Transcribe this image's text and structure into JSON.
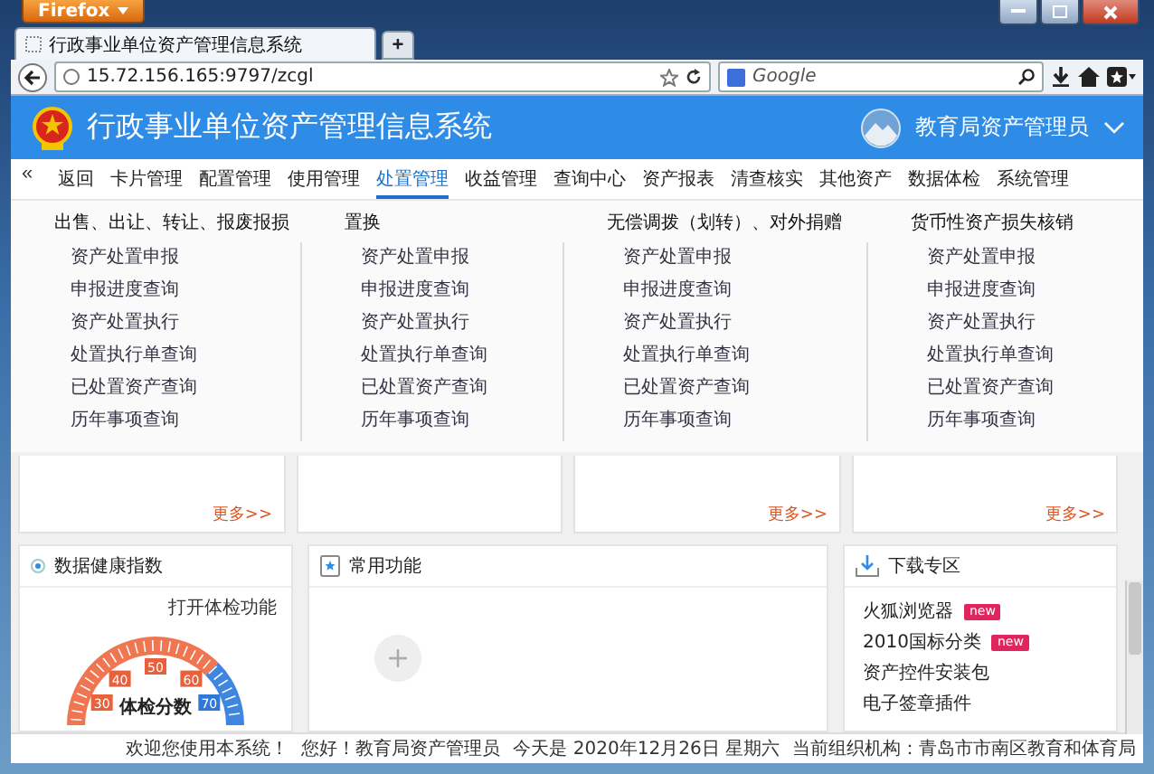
{
  "browser": {
    "menu_button": "Firefox",
    "tab_title": "行政事业单位资产管理信息系统",
    "new_tab": "+",
    "url": "15.72.156.165:9797/zcgl",
    "search_placeholder": "Google"
  },
  "app": {
    "title": "行政事业单位资产管理信息系统",
    "user": "教育局资产管理员"
  },
  "nav": {
    "collapse": "«",
    "items": [
      {
        "label": "返回",
        "selected": false
      },
      {
        "label": "卡片管理",
        "selected": false
      },
      {
        "label": "配置管理",
        "selected": false
      },
      {
        "label": "使用管理",
        "selected": false
      },
      {
        "label": "处置管理",
        "selected": true
      },
      {
        "label": "收益管理",
        "selected": false
      },
      {
        "label": "查询中心",
        "selected": false
      },
      {
        "label": "资产报表",
        "selected": false
      },
      {
        "label": "清查核实",
        "selected": false
      },
      {
        "label": "其他资产",
        "selected": false
      },
      {
        "label": "数据体检",
        "selected": false
      },
      {
        "label": "系统管理",
        "selected": false
      }
    ]
  },
  "menu_columns": [
    {
      "title": "出售、出让、转让、报废报损",
      "links": [
        "资产处置申报",
        "申报进度查询",
        "资产处置执行",
        "处置执行单查询",
        "已处置资产查询",
        "历年事项查询"
      ]
    },
    {
      "title": "置换",
      "links": [
        "资产处置申报",
        "申报进度查询",
        "资产处置执行",
        "处置执行单查询",
        "已处置资产查询",
        "历年事项查询"
      ]
    },
    {
      "title": "无偿调拨（划转）、对外捐赠",
      "links": [
        "资产处置申报",
        "申报进度查询",
        "资产处置执行",
        "处置执行单查询",
        "已处置资产查询",
        "历年事项查询"
      ]
    },
    {
      "title": "货币性资产损失核销",
      "links": [
        "资产处置申报",
        "申报进度查询",
        "资产处置执行",
        "处置执行单查询",
        "已处置资产查询",
        "历年事项查询"
      ]
    }
  ],
  "cards": [
    {
      "kind": "more",
      "more": "更多>>"
    },
    {
      "kind": "plain"
    },
    {
      "kind": "more",
      "more": "更多>>"
    },
    {
      "kind": "more",
      "more": "更多>>"
    }
  ],
  "health": {
    "title": "数据健康指数",
    "action": "打开体检功能",
    "score_label": "体检分数",
    "gauge_labels": [
      {
        "text": "30",
        "color": "#e8603c"
      },
      {
        "text": "40",
        "color": "#e8603c"
      },
      {
        "text": "50",
        "color": "#e8603c"
      },
      {
        "text": "60",
        "color": "#e8603c"
      },
      {
        "text": "70",
        "color": "#2f78d8"
      }
    ]
  },
  "common": {
    "title": "常用功能"
  },
  "downloads": {
    "title": "下载专区",
    "items": [
      {
        "label": "火狐浏览器",
        "badge": "new"
      },
      {
        "label": "2010国标分类",
        "badge": "new"
      },
      {
        "label": "资产控件安装包"
      },
      {
        "label": "电子签章插件"
      }
    ]
  },
  "status_bar": {
    "welcome": "欢迎您使用本系统！",
    "greeting": "您好！教育局资产管理员",
    "today": "今天是 2020年12月26日 星期六",
    "org": "当前组织机构：青岛市市南区教育和体育局"
  }
}
